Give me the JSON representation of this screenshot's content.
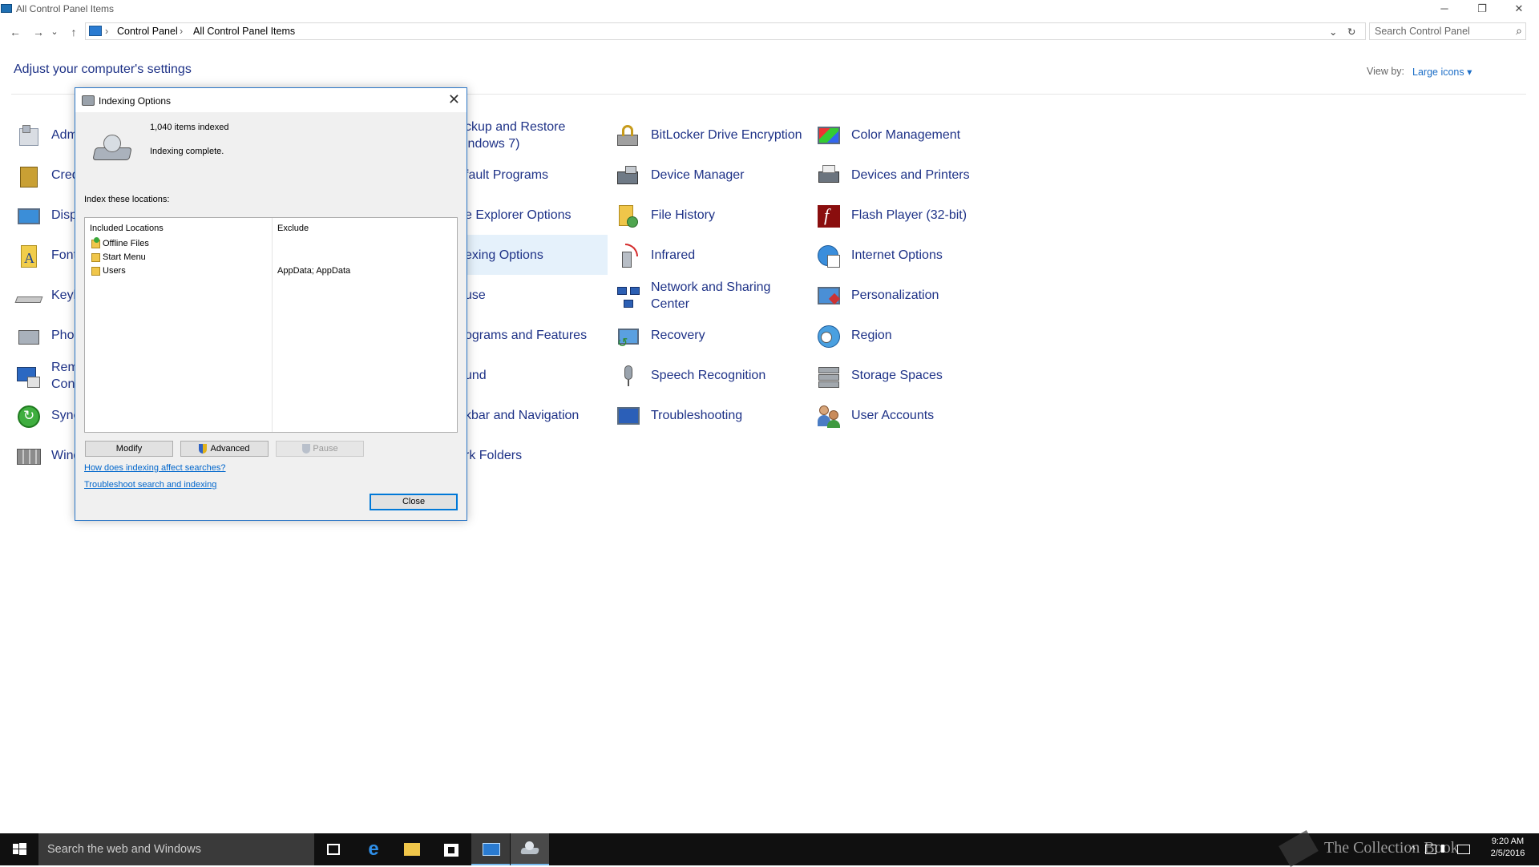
{
  "window": {
    "title": "All Control Panel Items",
    "controls": [
      "─",
      "❐",
      "✕"
    ]
  },
  "address": {
    "back_glyph": "←",
    "forward_glyph": "→",
    "recent_glyph": "⌄",
    "up_glyph": "↑",
    "crumb1": "Control Panel",
    "crumb2": "All Control Panel Items",
    "sep": "›",
    "dropdown_glyph": "⌄",
    "refresh_glyph": "↻",
    "search_placeholder": "Search Control Panel",
    "search_glyph": "⌕"
  },
  "header": {
    "title": "Adjust your computer's settings",
    "view_by_label": "View by:",
    "view_by_value": "Large icons ▾"
  },
  "items": {
    "col1": [
      {
        "label": "Adm"
      },
      {
        "label": "Cred"
      },
      {
        "label": "Disp"
      },
      {
        "label": "Font"
      },
      {
        "label": "Keyb"
      },
      {
        "label": "Phor"
      },
      {
        "label": "Rem",
        "label2": "Conn"
      },
      {
        "label": "Sync"
      },
      {
        "label": "Wind"
      }
    ],
    "col2": [
      {
        "label": "ckup and Restore",
        "label2": "indows 7)"
      },
      {
        "label": "fault Programs"
      },
      {
        "label": "e Explorer Options"
      },
      {
        "label": "exing Options"
      },
      {
        "label": "use"
      },
      {
        "label": "ograms and Features"
      },
      {
        "label": "und"
      },
      {
        "label": "kbar and Navigation"
      },
      {
        "label": "rk Folders"
      }
    ],
    "col3": [
      {
        "label": "BitLocker Drive Encryption",
        "icon": "bitlocker-icon"
      },
      {
        "label": "Device Manager",
        "icon": "device-manager-icon"
      },
      {
        "label": "File History",
        "icon": "file-history-icon"
      },
      {
        "label": "Infrared",
        "icon": "infrared-icon"
      },
      {
        "label": "Network and Sharing",
        "label2": "Center",
        "icon": "network-icon"
      },
      {
        "label": "Recovery",
        "icon": "recovery-icon"
      },
      {
        "label": "Speech Recognition",
        "icon": "microphone-icon"
      },
      {
        "label": "Troubleshooting",
        "icon": "troubleshooting-icon"
      }
    ],
    "col4": [
      {
        "label": "Color Management",
        "icon": "color-management-icon"
      },
      {
        "label": "Devices and Printers",
        "icon": "printer-icon"
      },
      {
        "label": "Flash Player (32-bit)",
        "icon": "flash-player-icon"
      },
      {
        "label": "Internet Options",
        "icon": "internet-options-icon"
      },
      {
        "label": "Personalization",
        "icon": "personalization-icon"
      },
      {
        "label": "Region",
        "icon": "region-icon"
      },
      {
        "label": "Storage Spaces",
        "icon": "storage-spaces-icon"
      },
      {
        "label": "User Accounts",
        "icon": "user-accounts-icon"
      }
    ]
  },
  "dialog": {
    "title": "Indexing Options",
    "close_glyph": "✕",
    "count": "1,040 items indexed",
    "status": "Indexing complete.",
    "locations_label": "Index these locations:",
    "columns": [
      "Included Locations",
      "Exclude"
    ],
    "rows": [
      {
        "location": "Offline Files",
        "exclude": ""
      },
      {
        "location": "Start Menu",
        "exclude": ""
      },
      {
        "location": "Users",
        "exclude": "AppData; AppData"
      }
    ],
    "modify": "Modify",
    "advanced": "Advanced",
    "pause": "Pause",
    "link1": "How does indexing affect searches?",
    "link2": "Troubleshoot search and indexing",
    "close": "Close"
  },
  "taskbar": {
    "search_placeholder": "Search the web and Windows",
    "watermark": "The Collection Book",
    "time": "9:20 AM",
    "date": "2/5/2016",
    "tray_up_glyph": "^"
  }
}
